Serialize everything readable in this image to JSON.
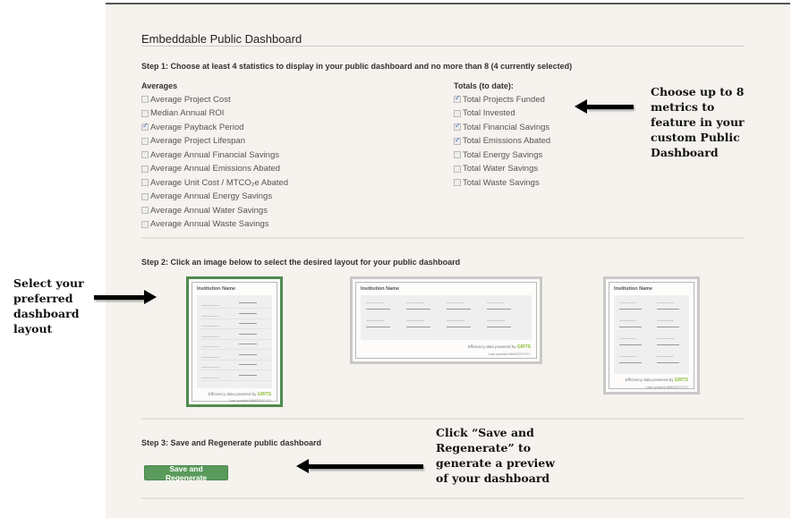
{
  "page": {
    "title": "Embeddable Public Dashboard"
  },
  "step1": {
    "label": "Step 1: Choose at least 4 statistics to display in your public dashboard and no more than 8 (4 currently selected)",
    "averages": {
      "heading": "Averages",
      "items": [
        {
          "label": "Average Project Cost",
          "checked": false
        },
        {
          "label": "Median Annual ROI",
          "checked": false
        },
        {
          "label": "Average Payback Period",
          "checked": true
        },
        {
          "label": "Average Project Lifespan",
          "checked": false
        },
        {
          "label": "Average Annual Financial Savings",
          "checked": false
        },
        {
          "label": "Average Annual Emissions Abated",
          "checked": false
        },
        {
          "label": "Average Unit Cost / MTCO₂e Abated",
          "checked": false
        },
        {
          "label": "Average Annual Energy Savings",
          "checked": false
        },
        {
          "label": "Average Annual Water Savings",
          "checked": false
        },
        {
          "label": "Average Annual Waste Savings",
          "checked": false
        }
      ]
    },
    "totals": {
      "heading": "Totals (to date):",
      "items": [
        {
          "label": "Total Projects Funded",
          "checked": true
        },
        {
          "label": "Total Invested",
          "checked": false
        },
        {
          "label": "Total Financial Savings",
          "checked": true
        },
        {
          "label": "Total Emissions Abated",
          "checked": true
        },
        {
          "label": "Total Energy Savings",
          "checked": false
        },
        {
          "label": "Total Water Savings",
          "checked": false
        },
        {
          "label": "Total Waste Savings",
          "checked": false
        }
      ]
    }
  },
  "step2": {
    "label": "Step 2: Click an image below to select the desired layout for your public dashboard",
    "layouts": [
      {
        "name": "single-column",
        "selected": true,
        "institution": "Institution Name",
        "footer": "Efficiency data powered by",
        "brand": "GRITS",
        "updated": "Last updated MM/DD/YYYY"
      },
      {
        "name": "four-column",
        "selected": false,
        "institution": "Institution Name",
        "footer": "Efficiency data powered by",
        "brand": "GRITS",
        "updated": "Last updated MM/DD/YYYY"
      },
      {
        "name": "two-column",
        "selected": false,
        "institution": "Institution Name",
        "footer": "Efficiency data powered by",
        "brand": "GRITS",
        "updated": "Last updated MM/DD/YYYY"
      }
    ]
  },
  "step3": {
    "label": "Step 3: Save and Regenerate public dashboard",
    "button": "Save and Regenerate"
  },
  "annotations": {
    "metrics": [
      "Choose up to 8",
      "metrics to",
      "feature in your",
      "custom Public",
      "Dashboard"
    ],
    "layout": [
      "Select your",
      "preferred",
      "dashboard",
      "layout"
    ],
    "save": [
      "Click “Save and",
      "Regenerate” to",
      "generate a preview",
      "of your dashboard"
    ]
  },
  "colors": {
    "panel_bg": "#f6f3ef",
    "button_green": "#5a9a5c",
    "selected_border": "#4f8b4f",
    "check_blue": "#3a5bb5"
  }
}
